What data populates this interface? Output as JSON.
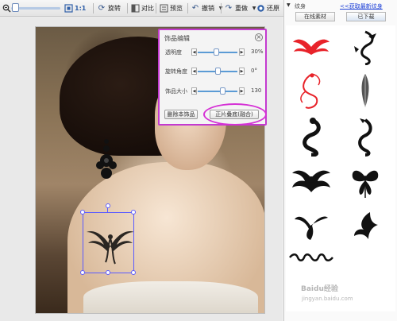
{
  "toolbar": {
    "zoom_label": "1:1",
    "rotate_label": "旋转",
    "compare_label": "对比",
    "preview_label": "预览",
    "undo_label": "撤销",
    "redo_label": "重做",
    "restore_label": "还原"
  },
  "panel": {
    "title": "饰品编辑",
    "rows": [
      {
        "label": "透明度",
        "value": "30%"
      },
      {
        "label": "旋转角度",
        "value": "0°"
      },
      {
        "label": "饰品大小",
        "value": "130"
      }
    ],
    "delete_label": "删除本饰品",
    "merge_label": "正片叠底(融合)"
  },
  "sidebar": {
    "title": "纹身",
    "link": "<<获取最新纹身",
    "tabs": [
      "在线素材",
      "已下载"
    ]
  },
  "watermark": {
    "text": "Baidu经验",
    "sub": "jingyan.baidu.com"
  },
  "colors": {
    "accent_magenta": "#c43ad0",
    "selection_blue": "#5b5bff",
    "tattoo_red": "#e8232a"
  },
  "icons": [
    "zoom-out-icon",
    "fit-icon",
    "rotate-icon",
    "compare-icon",
    "preview-icon",
    "undo-icon",
    "redo-icon",
    "restore-icon"
  ]
}
